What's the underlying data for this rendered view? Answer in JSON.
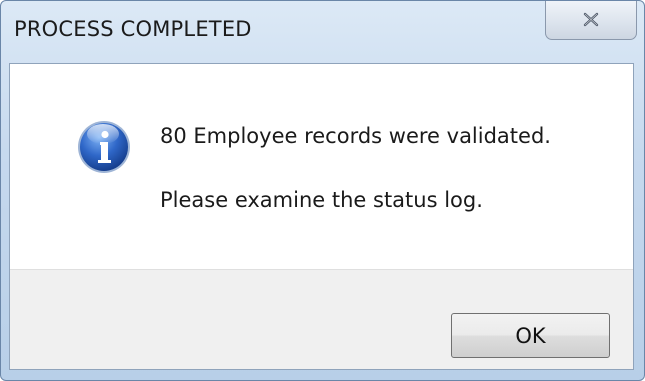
{
  "window": {
    "title": "PROCESS COMPLETED"
  },
  "dialog": {
    "icon": "information-icon",
    "message_line1": "80 Employee records were validated.",
    "message_line2": "Please examine the status log.",
    "ok_label": "OK"
  },
  "colors": {
    "titlebar": "#c6d9ee",
    "footer": "#f0f0f0",
    "icon_blue": "#1f4fa8"
  }
}
